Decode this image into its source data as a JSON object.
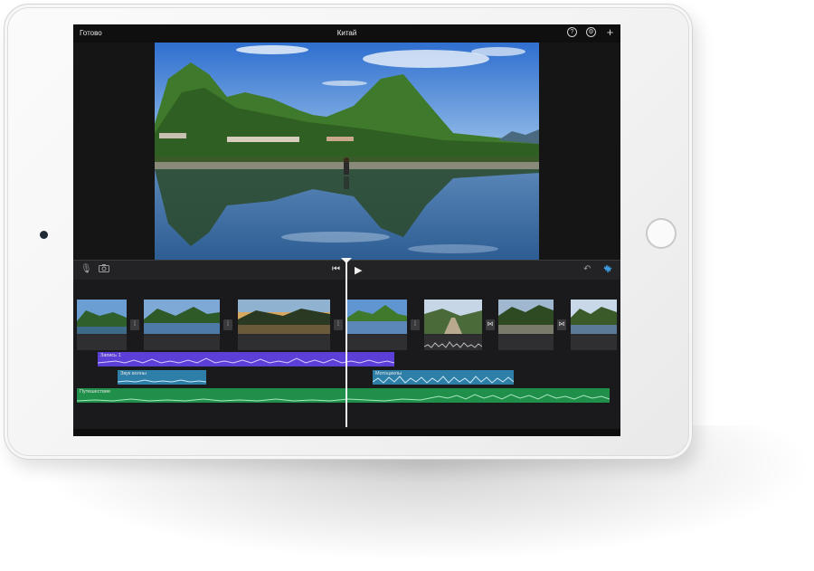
{
  "topbar": {
    "done_label": "Готово",
    "project_title": "Китай",
    "help_icon": "help-icon",
    "settings_icon": "gear-icon",
    "add_icon": "plus-icon"
  },
  "toolbar": {
    "icons": [
      "microphone-icon",
      "camera-icon",
      "skip-back-icon",
      "play-icon",
      "undo-icon",
      "waveform-icon"
    ]
  },
  "audio_tracks": {
    "recording": {
      "label": "Запись 1",
      "color": "#5b3fd6"
    },
    "wave_sound": {
      "label": "Звук волны",
      "color": "#2e7fa8"
    },
    "motorcycles": {
      "label": "Мотоциклы",
      "color": "#2e7fa8"
    },
    "music": {
      "label": "Путешествие",
      "color": "#1f8f4a"
    }
  },
  "colors": {
    "screen_bg": "#1c1c1e",
    "accent_blue": "#3fa9f5",
    "playhead": "#f5f5f5"
  }
}
